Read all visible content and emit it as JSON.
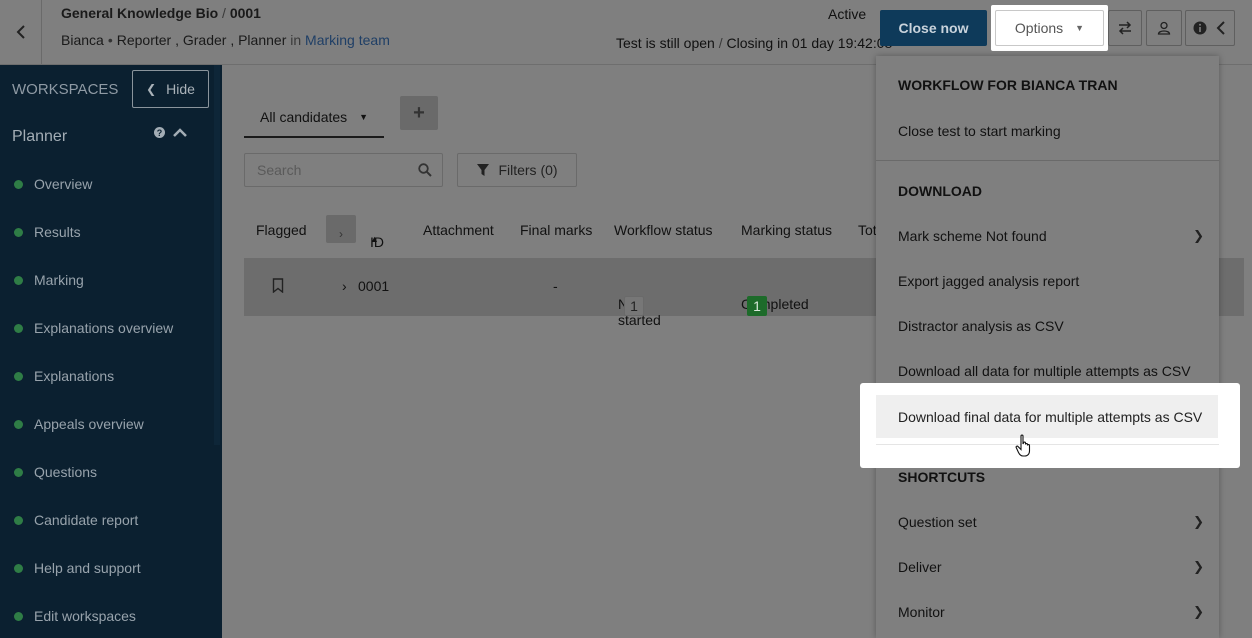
{
  "header": {
    "breadcrumb": {
      "title": "General Knowledge Bio",
      "separator": "/",
      "id": "0001"
    },
    "roles": {
      "user": "Bianca",
      "dot": "•",
      "role_list": "Reporter , Grader , Planner",
      "in_word": "in",
      "team_link": "Marking team"
    },
    "status": "Active",
    "open_text": "Test is still open",
    "open_sep": "/",
    "closing_text": "Closing in 01 day 19:42:08",
    "close_button": "Close now",
    "options_button": "Options"
  },
  "sidebar": {
    "title": "WORKSPACES",
    "hide_button": "Hide",
    "section": "Planner",
    "items": [
      {
        "label": "Overview"
      },
      {
        "label": "Results"
      },
      {
        "label": "Marking"
      },
      {
        "label": "Explanations overview"
      },
      {
        "label": "Explanations"
      },
      {
        "label": "Appeals overview"
      },
      {
        "label": "Questions"
      },
      {
        "label": "Candidate report"
      },
      {
        "label": "Help and support"
      },
      {
        "label": "Edit workspaces"
      }
    ]
  },
  "main": {
    "tab": "All candidates",
    "search_placeholder": "Search",
    "filters_button": "Filters (0)",
    "columns": {
      "flagged": "Flagged",
      "id": "ID",
      "attachment": "Attachment",
      "final_marks": "Final marks",
      "workflow_status": "Workflow status",
      "marking_status": "Marking status",
      "total": "Tot"
    },
    "row": {
      "id": "0001",
      "final_marks": "-",
      "workflow_status": "Not started",
      "workflow_count": "1",
      "marking_status": "Completed",
      "marking_count": "1"
    }
  },
  "menu": {
    "workflow_title": "WORKFLOW FOR BIANCA TRAN",
    "workflow_item": "Close test to start marking",
    "download_title": "DOWNLOAD",
    "download_items": [
      {
        "label": "Mark scheme Not found"
      },
      {
        "label": "Export jagged analysis report"
      },
      {
        "label": "Distractor analysis as CSV"
      },
      {
        "label": "Download all data for multiple attempts as CSV"
      }
    ],
    "highlighted_item": "Download final data for multiple attempts as CSV",
    "shortcuts_title": "SHORTCUTS",
    "shortcut_items": [
      {
        "label": "Question set"
      },
      {
        "label": "Deliver"
      },
      {
        "label": "Monitor"
      }
    ]
  }
}
